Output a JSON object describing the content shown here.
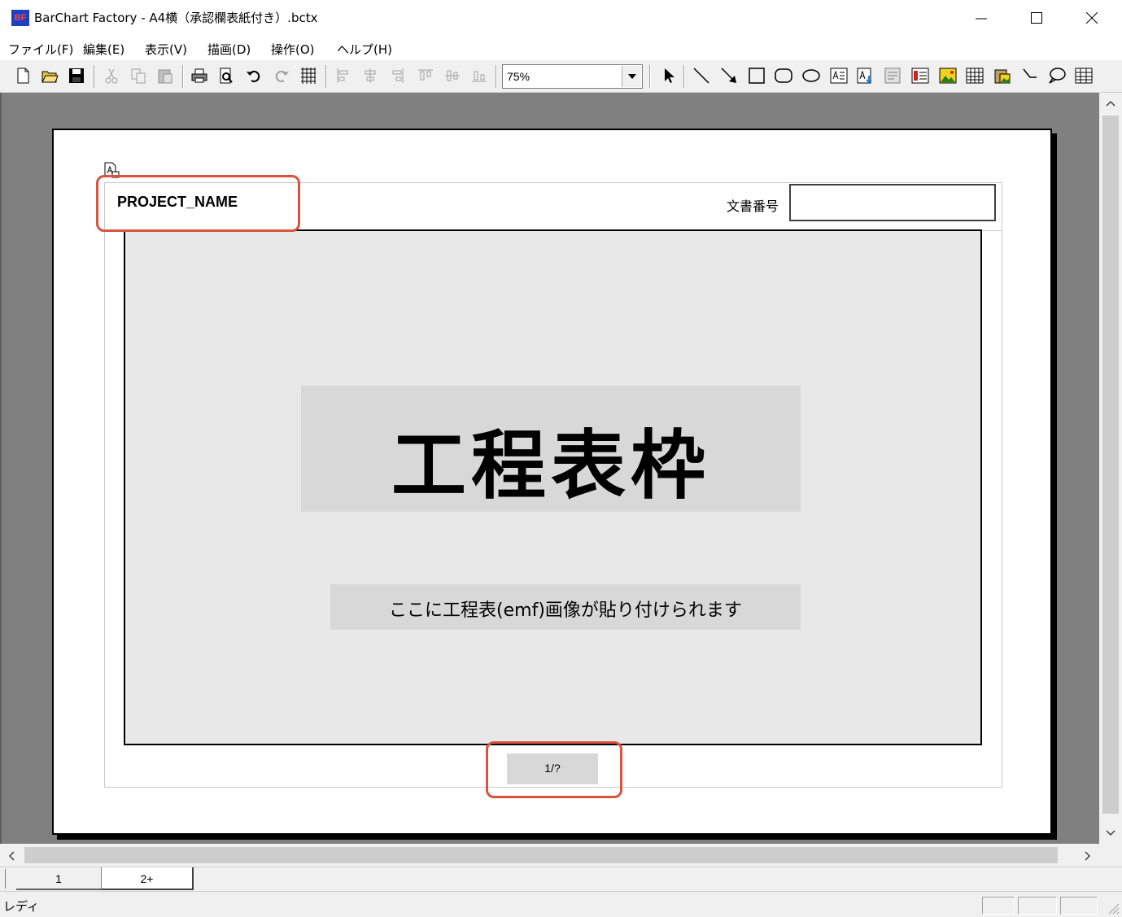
{
  "window": {
    "logo_text": "BF",
    "title": "BarChart Factory - A4横（承認欄表紙付き）.bctx"
  },
  "menu": {
    "file": "ファイル(F)",
    "edit": "編集(E)",
    "view": "表示(V)",
    "draw": "描画(D)",
    "operate": "操作(O)",
    "help": "ヘルプ(H)"
  },
  "toolbar": {
    "zoom": "75%"
  },
  "page": {
    "project_name": "PROJECT_NAME",
    "doc_number_label": "文書番号",
    "doc_number_value": "",
    "big_title": "工程表枠",
    "subtitle": "ここに工程表(emf)画像が貼り付けられます",
    "page_number": "1/?"
  },
  "tabs": [
    "1",
    "2+"
  ],
  "status": {
    "text": "レディ"
  },
  "colors": {
    "highlight": "#d9533f",
    "canvas": "#808080",
    "frame_fill": "#e8e8e8"
  }
}
